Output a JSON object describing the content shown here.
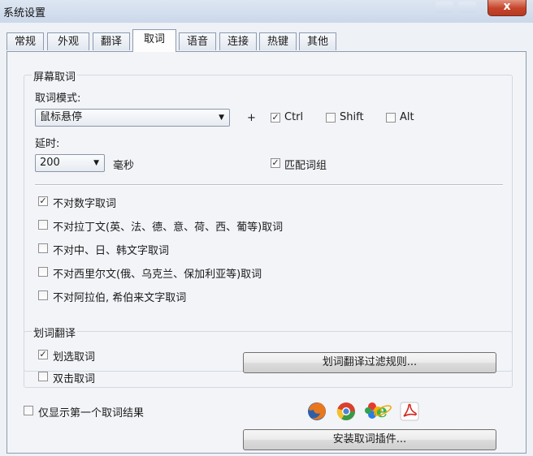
{
  "window": {
    "title": "系统设置",
    "close_label": "x"
  },
  "tabs": [
    {
      "label": "常规"
    },
    {
      "label": "外观"
    },
    {
      "label": "翻译"
    },
    {
      "label": "取词"
    },
    {
      "label": "语音"
    },
    {
      "label": "连接"
    },
    {
      "label": "热键"
    },
    {
      "label": "其他"
    }
  ],
  "active_tab": "取词",
  "screen_capture": {
    "group_label": "屏幕取词",
    "mode_label": "取词模式:",
    "mode_value": "鼠标悬停",
    "plus": "+",
    "ctrl": {
      "label": "Ctrl",
      "checked": true
    },
    "shift": {
      "label": "Shift",
      "checked": false
    },
    "alt": {
      "label": "Alt",
      "checked": false
    },
    "delay_label": "延时:",
    "delay_value": "200",
    "delay_unit": "毫秒",
    "match_phrase": {
      "label": "匹配词组",
      "checked": true
    },
    "options": [
      {
        "label": "不对数字取词",
        "checked": true
      },
      {
        "label": "不对拉丁文(英、法、德、意、荷、西、葡等)取词",
        "checked": false
      },
      {
        "label": "不对中、日、韩文字取词",
        "checked": false
      },
      {
        "label": "不对西里尔文(俄、乌克兰、保加利亚等)取词",
        "checked": false
      },
      {
        "label": "不对阿拉伯, 希伯来文字取词",
        "checked": false
      }
    ]
  },
  "selection_translate": {
    "group_label": "划词翻译",
    "select_capture": {
      "label": "划选取词",
      "checked": true
    },
    "dblclick_capture": {
      "label": "双击取词",
      "checked": false
    },
    "filter_button": "划词翻译过滤规则..."
  },
  "first_result_only": {
    "label": "仅显示第一个取词结果",
    "checked": false
  },
  "install_plugin_button": "安装取词插件...",
  "plugin_icons": [
    "firefox-icon",
    "chrome-icon",
    "ie-icon",
    "acrobat-icon"
  ],
  "check_mark": "✓"
}
